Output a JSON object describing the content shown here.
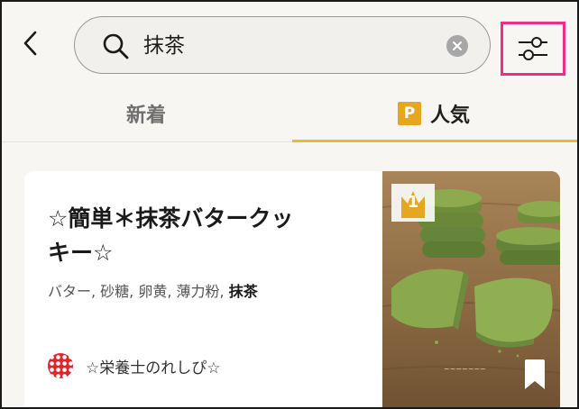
{
  "search": {
    "query": "抹茶"
  },
  "tabs": [
    {
      "label": "新着"
    },
    {
      "label": "人気",
      "badge": "P"
    }
  ],
  "recipe": {
    "title_line1": "☆簡単＊抹茶バタークッ",
    "title_line2": "キー☆",
    "ingredients": "バター, 砂糖, 卵黄, 薄力粉, ",
    "ingredients_highlight": "抹茶",
    "author": "☆栄養士のれしぴ☆",
    "rank": "1"
  },
  "icons": {
    "back": "chevron-left-icon",
    "search": "search-icon",
    "clear": "clear-icon",
    "filter": "sliders-icon",
    "bookmark": "bookmark-icon",
    "premium": "premium-badge-icon",
    "rank": "crown-icon"
  },
  "colors": {
    "accent_underline": "#e9ba3d",
    "premium_badge": "#e6a71f",
    "filter_highlight": "#ec2f84",
    "avatar": "#e3242b"
  }
}
